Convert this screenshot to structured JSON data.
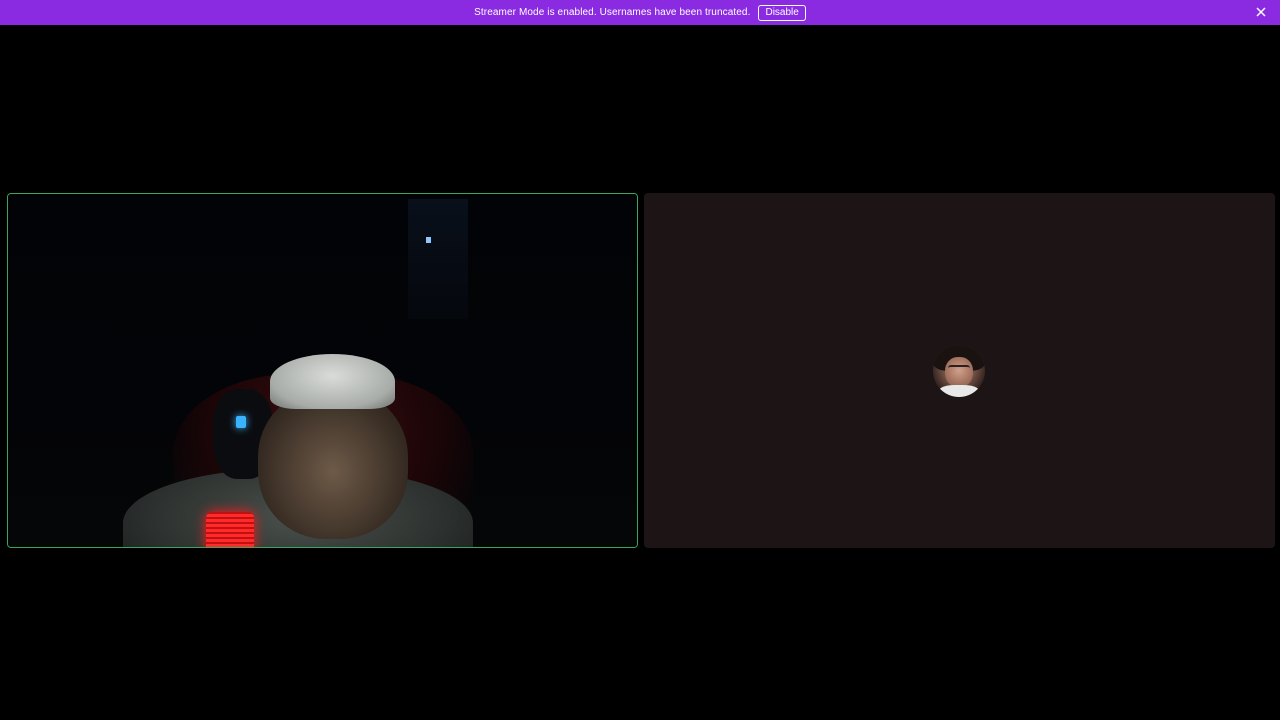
{
  "notice": {
    "message": "Streamer Mode is enabled. Usernames have been truncated.",
    "disable_label": "Disable",
    "close_icon": "close-icon",
    "background_color": "#8a2be2"
  },
  "tiles": {
    "left": {
      "type": "video",
      "speaking": true,
      "border_color": "#3ba55c"
    },
    "right": {
      "type": "avatar",
      "background_color": "#1d1416"
    }
  }
}
